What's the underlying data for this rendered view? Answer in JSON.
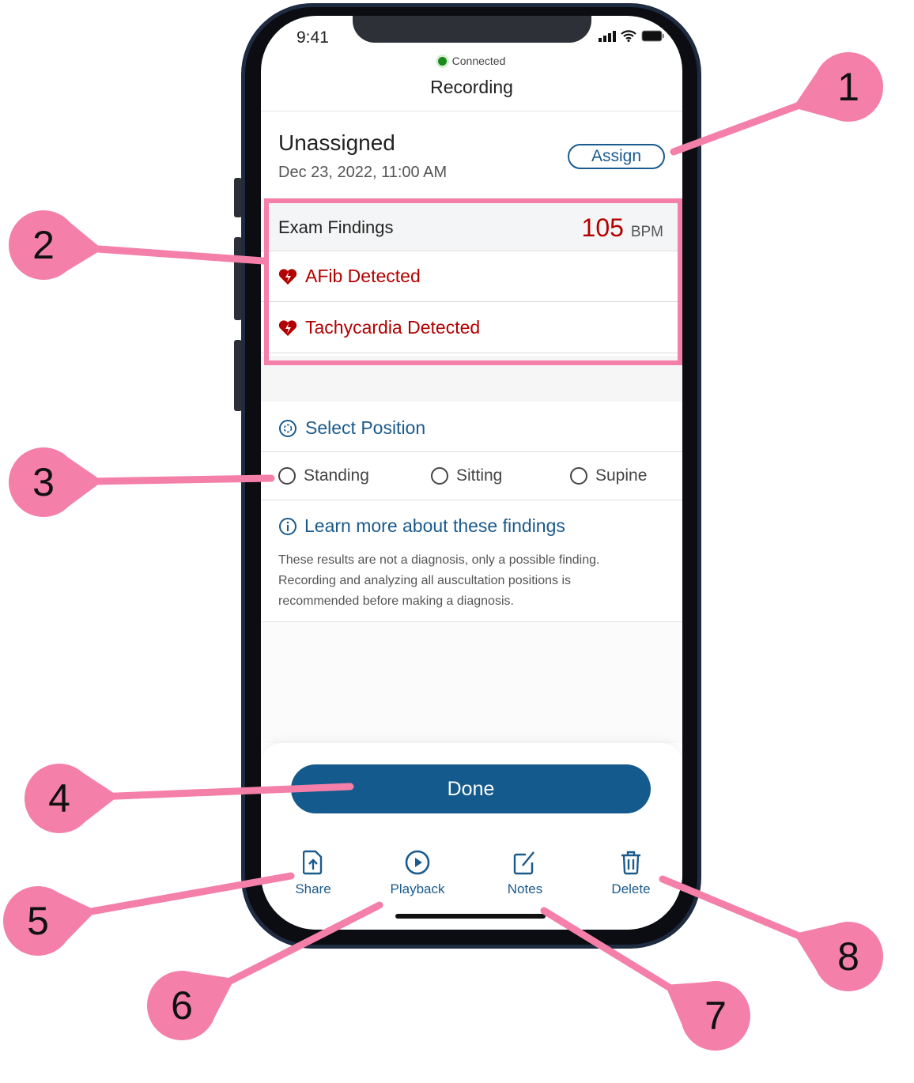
{
  "status_bar": {
    "time": "9:41"
  },
  "header": {
    "connection": "Connected",
    "title": "Recording"
  },
  "recording": {
    "patient": "Unassigned",
    "date": "Dec 23, 2022, 11:00 AM",
    "assign_label": "Assign"
  },
  "findings": {
    "title": "Exam Findings",
    "bpm_value": "105",
    "bpm_unit": "BPM",
    "items": [
      "AFib Detected",
      "Tachycardia Detected"
    ],
    "alert_color": "#b30000"
  },
  "position": {
    "title": "Select Position",
    "options": [
      "Standing",
      "Sitting",
      "Supine"
    ]
  },
  "info": {
    "link": "Learn more about these findings",
    "disclaimer": "These results are not a diagnosis, only a possible finding. Recording and analyzing all auscultation positions is recommended before making a diagnosis."
  },
  "done_label": "Done",
  "tabs": [
    {
      "label": "Share",
      "icon": "share-file-icon"
    },
    {
      "label": "Playback",
      "icon": "play-icon"
    },
    {
      "label": "Notes",
      "icon": "edit-icon"
    },
    {
      "label": "Delete",
      "icon": "trash-icon"
    }
  ],
  "callouts": [
    "1",
    "2",
    "3",
    "4",
    "5",
    "6",
    "7",
    "8"
  ],
  "colors": {
    "primary": "#155a8c",
    "callout": "#f47fa8"
  }
}
